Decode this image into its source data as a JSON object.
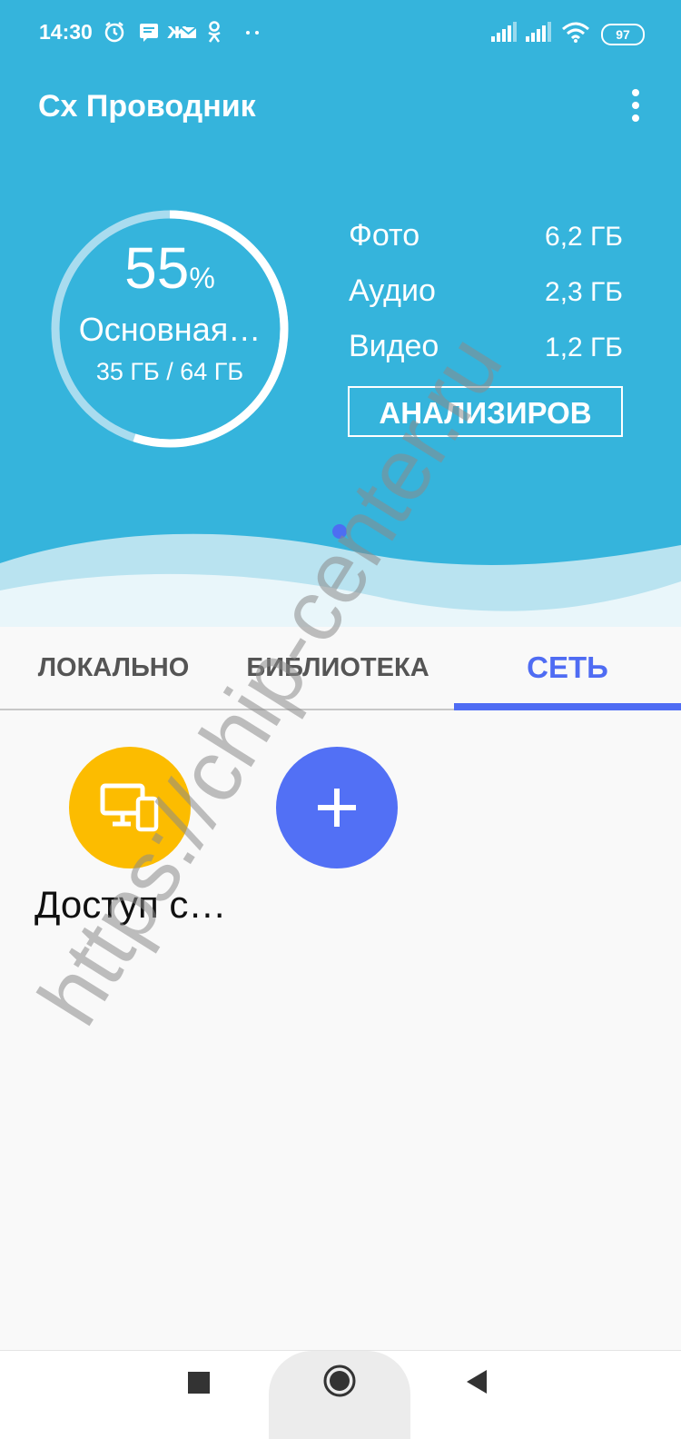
{
  "status_bar": {
    "time": "14:30",
    "battery": "97",
    "icons": [
      "alarm-icon",
      "message-icon",
      "mail-icon",
      "ok-icon",
      "more-notifications-icon",
      "signal-icon",
      "signal-icon",
      "wifi-icon",
      "battery-icon"
    ]
  },
  "app_bar": {
    "title": "Cx Проводник",
    "menu_icon": "more-vert-icon"
  },
  "storage": {
    "percent": "55",
    "percent_sign": "%",
    "percent_value": 0.55,
    "name": "Основная…",
    "usage": "35 ГБ / 64 ГБ"
  },
  "categories": [
    {
      "label": "Фото",
      "value": "6,2 ГБ"
    },
    {
      "label": "Аудио",
      "value": "2,3 ГБ"
    },
    {
      "label": "Видео",
      "value": "1,2 ГБ"
    }
  ],
  "analyze_label": "АНАЛИЗИРОВ",
  "tabs": [
    {
      "label": "ЛОКАЛЬНО",
      "active": false
    },
    {
      "label": "БИБЛИОТЕКА",
      "active": false
    },
    {
      "label": "СЕТЬ",
      "active": true
    }
  ],
  "network_items": [
    {
      "label": "Доступ с…",
      "icon": "devices-icon",
      "color": "#fcbc00"
    },
    {
      "label": "",
      "icon": "plus-icon",
      "color": "#5270f5"
    }
  ],
  "watermark": "https://chip-center.ru",
  "colors": {
    "header": "#35b4dc",
    "accent": "#4f6cf3",
    "share_button": "#fcbc00",
    "add_button": "#5270f5"
  },
  "navigation": [
    "recents-button",
    "home-button",
    "back-button"
  ]
}
